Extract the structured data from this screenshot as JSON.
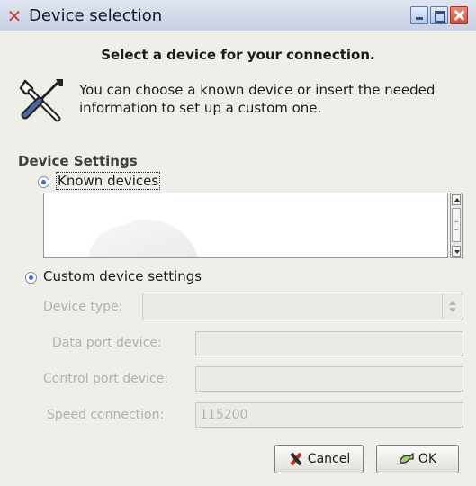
{
  "window": {
    "title": "Device selection",
    "controls": [
      "minimize",
      "maximize",
      "close"
    ]
  },
  "header": {
    "heading": "Select a device for your connection.",
    "info_line1": "You can choose a known device or insert the needed",
    "info_line2": "information to set up a custom one.",
    "icon": "tools-icon"
  },
  "settings": {
    "section_title": "Device Settings",
    "known_devices": {
      "label": "Known devices",
      "selected": true
    },
    "custom_device": {
      "label": "Custom device settings",
      "selected": false
    },
    "device_type": {
      "label": "Device type:",
      "value": ""
    },
    "data_port": {
      "label": "Data port device:",
      "value": ""
    },
    "control_port": {
      "label": "Control port device:",
      "value": ""
    },
    "speed": {
      "label": "Speed connection:",
      "value": "115200"
    }
  },
  "buttons": {
    "cancel_mnemonic": "C",
    "cancel_rest": "ancel",
    "ok_mnemonic": "O",
    "ok_rest": "K"
  },
  "colors": {
    "window_bg": "#efeee9",
    "titlebar": "#c8d1e2",
    "close_button": "#d04a37",
    "disabled_text": "#b1b0ab"
  }
}
